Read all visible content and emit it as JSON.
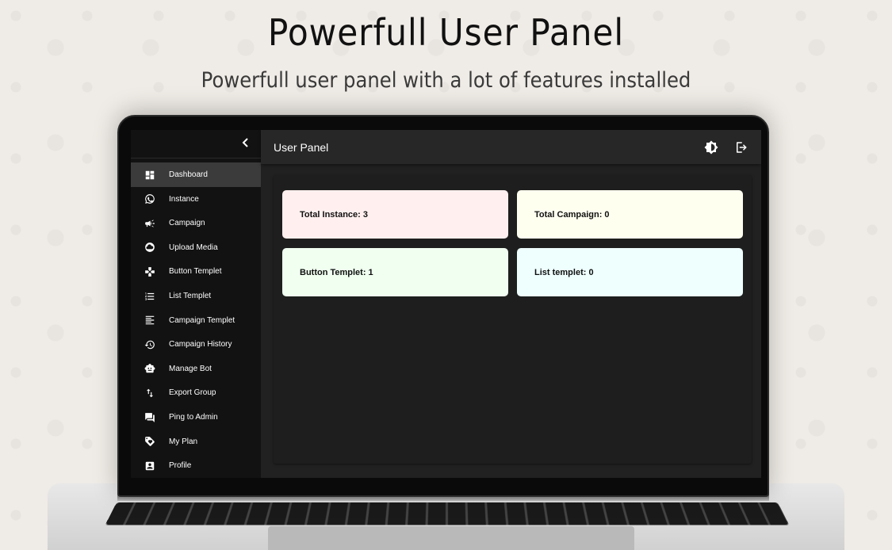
{
  "promo": {
    "headline": "Powerfull User Panel",
    "subline": "Powerfull user panel with a lot of features installed"
  },
  "app": {
    "title": "User Panel",
    "collapse_icon": "chevron-left-icon",
    "header_icons": [
      "theme-toggle-icon",
      "logout-icon"
    ]
  },
  "sidebar": {
    "active_index": 0,
    "items": [
      {
        "label": "Dashboard",
        "icon": "dashboard-icon"
      },
      {
        "label": "Instance",
        "icon": "whatsapp-icon"
      },
      {
        "label": "Campaign",
        "icon": "megaphone-icon"
      },
      {
        "label": "Upload Media",
        "icon": "cloud-icon"
      },
      {
        "label": "Button Templet",
        "icon": "gamepad-icon"
      },
      {
        "label": "List Templet",
        "icon": "list-icon"
      },
      {
        "label": "Campaign Templet",
        "icon": "text-align-icon"
      },
      {
        "label": "Campaign History",
        "icon": "history-icon"
      },
      {
        "label": "Manage Bot",
        "icon": "bot-icon"
      },
      {
        "label": "Export Group",
        "icon": "swap-vertical-icon"
      },
      {
        "label": "Ping to Admin",
        "icon": "chat-icon"
      },
      {
        "label": "My Plan",
        "icon": "tag-icon"
      },
      {
        "label": "Profile",
        "icon": "profile-icon"
      }
    ]
  },
  "stats": [
    {
      "label": "Total Instance: 3",
      "color": "#fff0ef"
    },
    {
      "label": "Total Campaign: 0",
      "color": "#fffff0"
    },
    {
      "label": "Button Templet: 1",
      "color": "#f0fff0"
    },
    {
      "label": "List templet: 0",
      "color": "#eefffe"
    }
  ]
}
